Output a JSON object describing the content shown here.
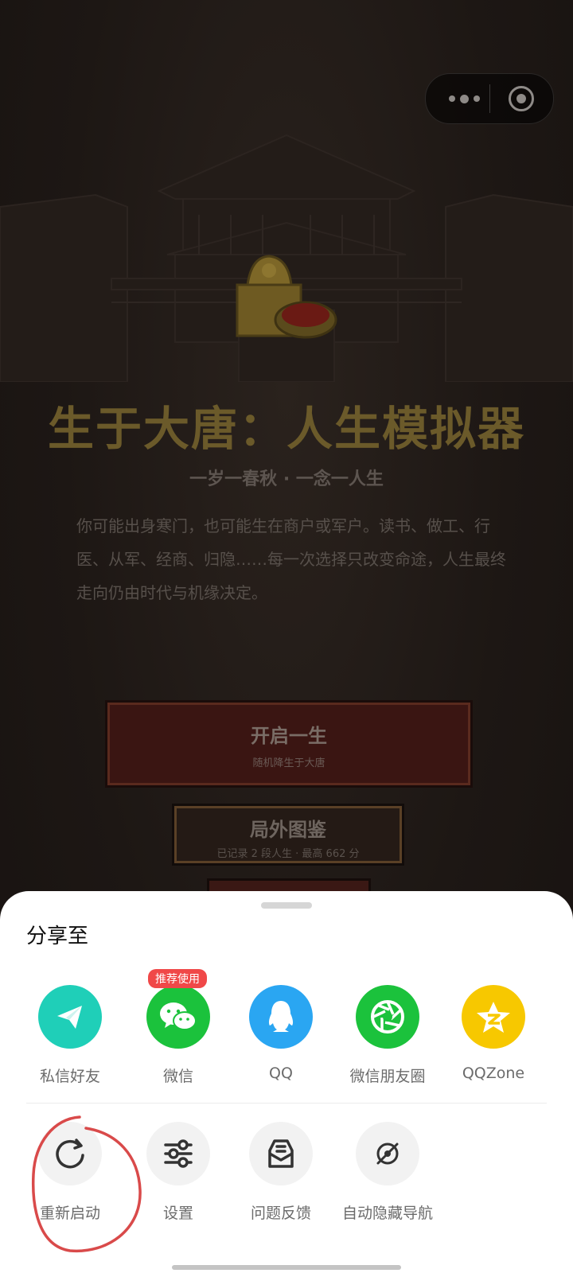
{
  "game": {
    "title": "生于大唐：人生模拟器",
    "subtitle": "一岁一春秋 · 一念一人生",
    "intro": "你可能出身寒门，也可能生在商户或军户。读书、做工、行医、从军、经商、归隐……每一次选择只改变命途，人生最终走向仍由时代与机缘决定。",
    "start_button": {
      "label": "开启一生",
      "sub": "随机降生于大唐"
    },
    "codex_button": {
      "label": "局外图鉴",
      "sub": "已记录 2 段人生 · 最高 662 分"
    }
  },
  "share_sheet": {
    "title": "分享至",
    "share_targets": [
      {
        "label": "私信好友",
        "icon": "paper-plane-icon",
        "color": "#1fcfb8"
      },
      {
        "label": "微信",
        "icon": "wechat-icon",
        "color": "#1bc23c",
        "badge": "推荐使用"
      },
      {
        "label": "QQ",
        "icon": "qq-penguin-icon",
        "color": "#2aa6f2"
      },
      {
        "label": "微信朋友圈",
        "icon": "moments-shutter-icon",
        "color": "#1bc23c"
      },
      {
        "label": "QQZone",
        "icon": "qzone-star-icon",
        "color": "#f7c800"
      }
    ],
    "actions": [
      {
        "label": "重新启动",
        "icon": "restart-icon"
      },
      {
        "label": "设置",
        "icon": "sliders-icon"
      },
      {
        "label": "问题反馈",
        "icon": "feedback-icon"
      },
      {
        "label": "自动隐藏导航",
        "icon": "hide-nav-icon"
      }
    ]
  },
  "colors": {
    "annotation_red": "#d94a4a",
    "title_gold": "#6b5a2a"
  }
}
